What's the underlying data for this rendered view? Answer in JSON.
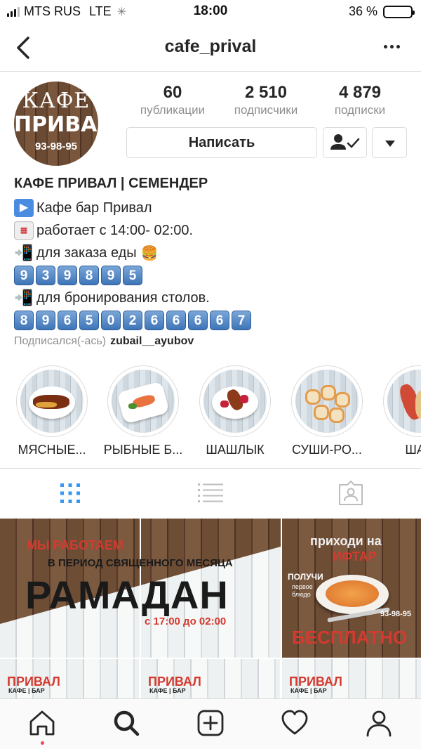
{
  "status_bar": {
    "carrier": "MTS RUS",
    "network": "LTE",
    "time": "18:00",
    "battery": "36 %",
    "battery_level_percent": 36
  },
  "header": {
    "title": "cafe_prival"
  },
  "profile": {
    "avatar": {
      "line1": "КАФЕ",
      "line2": "ПРИВАЛ",
      "line3": "93-98-95"
    },
    "stats": [
      {
        "value": "60",
        "label": "публикации"
      },
      {
        "value": "2 510",
        "label": "подписчики"
      },
      {
        "value": "4 879",
        "label": "подписки"
      }
    ],
    "message_button": "Написать"
  },
  "bio": {
    "name": "КАФЕ ПРИВАЛ | СЕМЕНДЕР",
    "line1": "Кафе бар Привал",
    "line2": "работает с 14:00- 02:00.",
    "line3": "для заказа еды",
    "order_phone": [
      "9",
      "3",
      "9",
      "8",
      "9",
      "5"
    ],
    "line4": " для бронирования столов.",
    "booking_phone": [
      "8",
      "9",
      "6",
      "5",
      "0",
      "2",
      "6",
      "6",
      "6",
      "6",
      "7"
    ],
    "followed_by_label": "Подписался(-ась)",
    "followed_by_user": "zubail__ayubov"
  },
  "highlights": [
    {
      "label": "МЯСНЫЕ..."
    },
    {
      "label": "РЫБНЫЕ Б..."
    },
    {
      "label": "ШАШЛЫК"
    },
    {
      "label": "СУШИ-РО..."
    },
    {
      "label": "ШАУ"
    }
  ],
  "posts": {
    "big": {
      "line1": "МЫ РАБОТАЕМ",
      "line2": "В ПЕРИОД СВЯЩЕННОГО МЕСЯЦА",
      "line3": "РАМАДАН",
      "line4": "с 17:00 до 02:00"
    },
    "right": {
      "line1": "приходи на",
      "line2": "ИФТАР",
      "line3": "ПОЛУЧИ",
      "line4": "первое",
      "line5": "блюдо",
      "phone": "93-98-95",
      "line6": "БЕСПЛАТНО"
    },
    "tile": {
      "title": "ПРИВАЛ",
      "sub": "КАФЕ | БАР"
    }
  },
  "colors": {
    "accent_blue": "#3897f0",
    "text_primary": "#262626",
    "text_secondary": "#8e8e8e",
    "border": "#dbdbdb",
    "notification_red": "#ed4956"
  }
}
